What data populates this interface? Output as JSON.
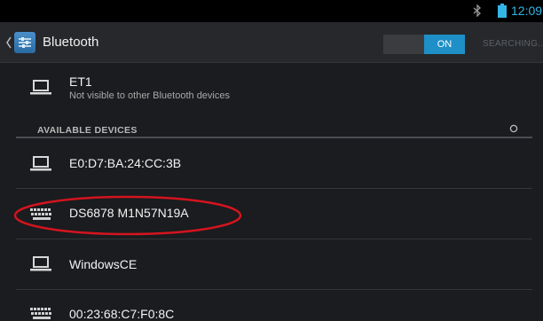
{
  "status_bar": {
    "time": "12:09",
    "bluetooth_icon": "bluetooth-icon",
    "battery_icon": "battery-icon"
  },
  "action_bar": {
    "title": "Bluetooth",
    "switch_state": "ON",
    "status_text": "SEARCHING..."
  },
  "paired_device": {
    "name": "ET1",
    "subtitle": "Not visible to other Bluetooth devices",
    "icon": "laptop-icon"
  },
  "available": {
    "header": "AVAILABLE DEVICES",
    "devices": [
      {
        "name": "E0:D7:BA:24:CC:3B",
        "icon": "laptop-icon"
      },
      {
        "name": "DS6878 M1N57N19A",
        "icon": "keyboard-icon",
        "highlighted": true
      },
      {
        "name": "WindowsCE",
        "icon": "laptop-icon"
      },
      {
        "name": "00:23:68:C7:F0:8C",
        "icon": "keyboard-icon"
      }
    ]
  },
  "colors": {
    "accent": "#33b5e5",
    "switch_on": "#1e8fc7",
    "highlight": "#d4141e",
    "background": "#1a1c1f"
  }
}
